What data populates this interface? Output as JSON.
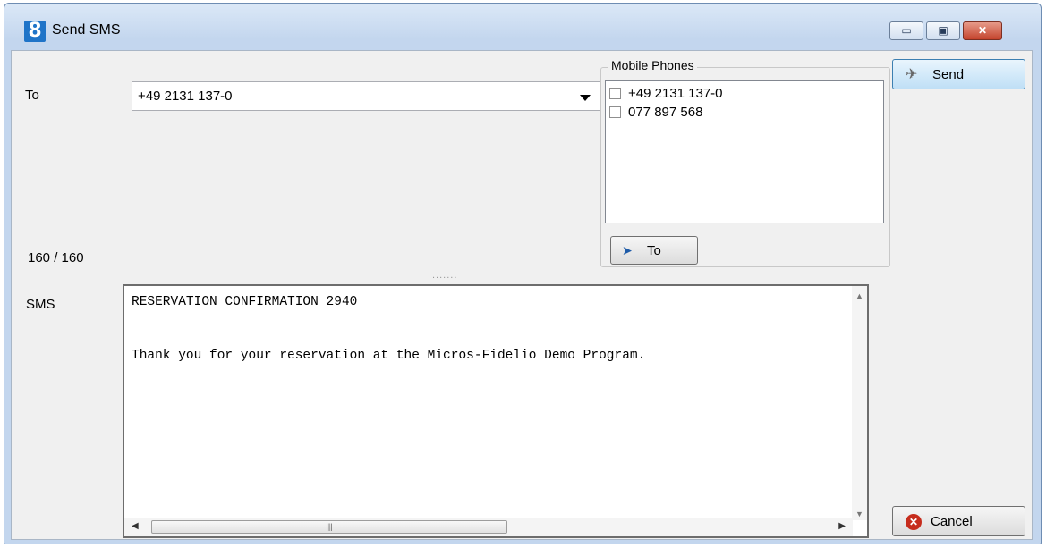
{
  "window": {
    "title": "Send SMS",
    "icon_glyph": "8",
    "controls": {
      "minimize": "▭",
      "maximize": "▣",
      "close": "✕"
    }
  },
  "form": {
    "to_label": "To",
    "to_value": "+49 2131 137-0",
    "char_count": "160 / 160",
    "sms_label": "SMS",
    "sms_text": "RESERVATION CONFIRMATION 2940\n\n\nThank you for your reservation at the Micros-Fidelio Demo Program."
  },
  "mobile_phones": {
    "title": "Mobile Phones",
    "items": [
      {
        "label": "+49 2131 137-0",
        "checked": false
      },
      {
        "label": "077 897 568",
        "checked": false
      }
    ],
    "to_button_label": "To"
  },
  "actions": {
    "send_label": "Send",
    "cancel_label": "Cancel"
  },
  "icons": {
    "send": "paper-plane-icon",
    "cancel": "cancel-x-icon",
    "to_button": "cursor-arrow-icon"
  },
  "colors": {
    "title_gradient_top": "#dbe8f7",
    "client_bg": "#f0f0f0",
    "close_button": "#c4432c",
    "cancel_icon": "#c62c1c"
  },
  "splitter_grip": "......."
}
